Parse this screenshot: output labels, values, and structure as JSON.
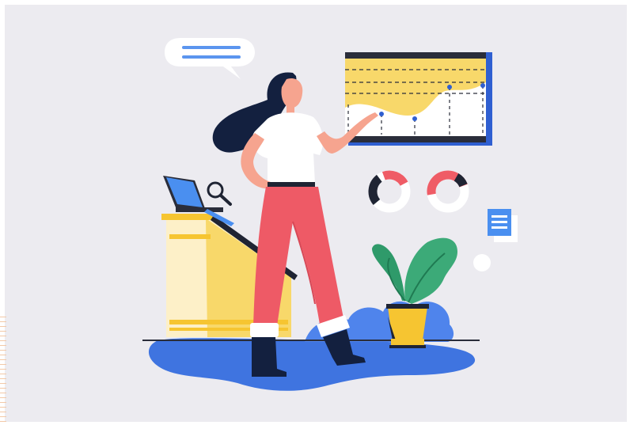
{
  "illustration": {
    "subject": "presenter-with-chart",
    "colors": {
      "background": "#ecebf0",
      "floor_blue": "#3f74e0",
      "chart_yellow": "#f8d86a",
      "chart_frame": "#2a2d3a",
      "chart_accent": "#2f5fd1",
      "pants": "#ee5a66",
      "hair": "#13203f",
      "skin": "#f6a48f",
      "plant_green": "#2f9a6a",
      "pot_yellow": "#f6c531",
      "podium_cream": "#fdf0c8",
      "podium_yellow": "#f8d86a",
      "donut_red": "#ef5c66",
      "donut_dark": "#1f2433",
      "doc_blue": "#4a8ff0"
    },
    "icons": [
      "speech-bubble-icon",
      "magnifier-icon",
      "document-icon",
      "laptop-icon"
    ]
  }
}
